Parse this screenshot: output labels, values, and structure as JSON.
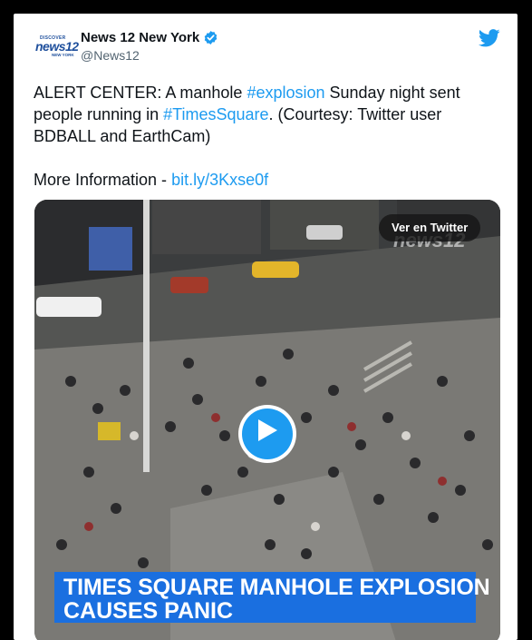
{
  "tweet": {
    "account_name": "News 12 New York",
    "handle": "@News12",
    "logo": {
      "line1": "DISCOVER",
      "line2": "news12",
      "line3": "NEW YORK"
    },
    "icons": {
      "verified": "verified-badge-icon",
      "twitter": "twitter-bird-icon",
      "play": "play-icon"
    },
    "text": {
      "line1_prefix": "ALERT CENTER: A manhole ",
      "hashtag1": "#explosion",
      "line1_suffix": " Sunday night sent people running in ",
      "hashtag2": "#TimesSquare",
      "line2_suffix": ". (Courtesy: Twitter user BDBALL and EarthCam)",
      "more_prefix": "More Information - ",
      "link": "bit.ly/3Kxse0f"
    },
    "media": {
      "view_button": "Ver en Twitter",
      "watermark": "news12",
      "banner_line1": "TIMES SQUARE MANHOLE EXPLOSION",
      "banner_line2": "CAUSES PANIC"
    },
    "colors": {
      "link": "#1d9bf0",
      "banner": "#1a6fe0",
      "verified": "#1d9bf0"
    }
  }
}
